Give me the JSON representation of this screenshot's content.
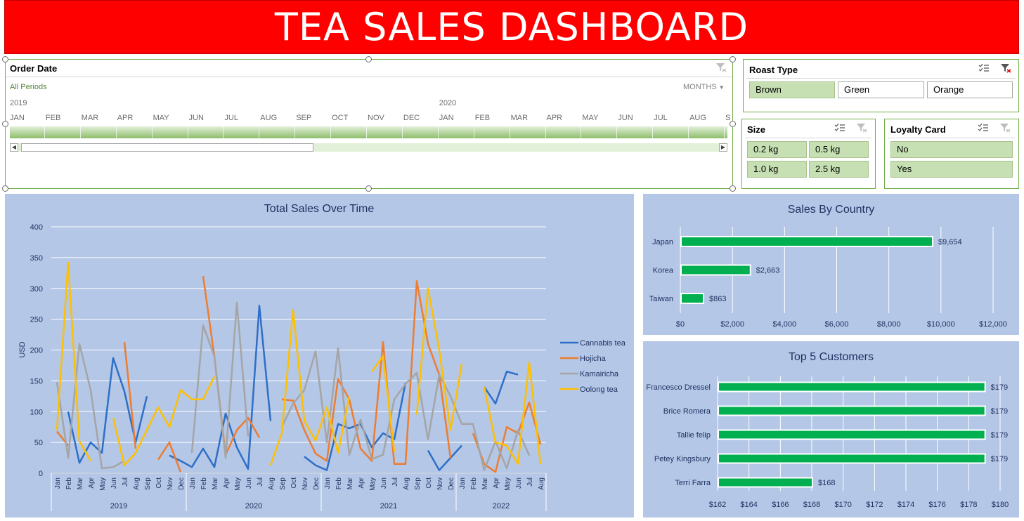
{
  "banner": {
    "title": "TEA SALES DASHBOARD"
  },
  "timeline": {
    "title": "Order Date",
    "period_label": "All Periods",
    "unit_label": "MONTHS",
    "years": [
      "2019",
      "2020"
    ],
    "months": [
      "JAN",
      "FEB",
      "MAR",
      "APR",
      "MAY",
      "JUN",
      "JUL",
      "AUG",
      "SEP",
      "OCT",
      "NOV",
      "DEC",
      "JAN",
      "FEB",
      "MAR",
      "APR",
      "MAY",
      "JUN",
      "JUL",
      "AUG",
      "S"
    ]
  },
  "roast": {
    "title": "Roast Type",
    "items": [
      {
        "label": "Brown",
        "selected": true
      },
      {
        "label": "Green",
        "selected": false
      },
      {
        "label": "Orange",
        "selected": false
      }
    ]
  },
  "size": {
    "title": "Size",
    "items": [
      {
        "label": "0.2 kg"
      },
      {
        "label": "0.5 kg"
      },
      {
        "label": "1.0 kg"
      },
      {
        "label": "2.5 kg"
      }
    ]
  },
  "loyalty": {
    "title": "Loyalty Card",
    "items": [
      {
        "label": "No"
      },
      {
        "label": "Yes"
      }
    ]
  },
  "colors": {
    "green": "#00b050",
    "accent": "#70ad47",
    "chart_bg": "#b4c7e7",
    "title_text": "#1f2f5f",
    "banner": "#ff0000"
  },
  "chart_data": [
    {
      "type": "line",
      "title": "Total Sales Over Time",
      "ylabel": "USD",
      "ylim": [
        0,
        400
      ],
      "yticks": [
        0,
        50,
        100,
        150,
        200,
        250,
        300,
        350,
        400
      ],
      "legend": "right",
      "years": [
        {
          "label": "2019",
          "count": 12
        },
        {
          "label": "2020",
          "count": 12
        },
        {
          "label": "2021",
          "count": 12
        },
        {
          "label": "2022",
          "count": 8
        }
      ],
      "categories": [
        "Jan",
        "Feb",
        "Mar",
        "Apr",
        "May",
        "Jun",
        "Jul",
        "Aug",
        "Sep",
        "Oct",
        "Nov",
        "Dec",
        "Jan",
        "Feb",
        "Mar",
        "Apr",
        "May",
        "Jun",
        "Jul",
        "Aug",
        "Sep",
        "Oct",
        "Nov",
        "Dec",
        "Jan",
        "Feb",
        "Mar",
        "Apr",
        "May",
        "Jun",
        "Jul",
        "Aug",
        "Sep",
        "Oct",
        "Nov",
        "Dec",
        "Jan",
        "Feb",
        "Mar",
        "Apr",
        "May",
        "Jun",
        "Jul",
        "Aug"
      ],
      "series": [
        {
          "name": "Cannabis tea",
          "color": "#2e6fc7",
          "values": [
            null,
            100,
            17,
            50,
            33,
            187,
            133,
            50,
            125,
            null,
            29,
            20,
            10,
            40,
            10,
            97,
            42,
            7,
            272,
            85,
            null,
            null,
            27,
            13,
            5,
            80,
            73,
            80,
            42,
            65,
            55,
            147,
            null,
            37,
            5,
            25,
            45,
            null,
            140,
            113,
            165,
            160,
            null,
            null
          ]
        },
        {
          "name": "Hojicha",
          "color": "#ed7d31",
          "values": [
            68,
            45,
            null,
            null,
            null,
            null,
            213,
            40,
            null,
            22,
            50,
            2,
            null,
            320,
            190,
            30,
            70,
            90,
            58,
            null,
            120,
            118,
            70,
            32,
            20,
            153,
            120,
            40,
            20,
            213,
            15,
            15,
            312,
            210,
            160,
            25,
            null,
            65,
            15,
            2,
            75,
            65,
            115,
            47
          ]
        },
        {
          "name": "Kamairicha",
          "color": "#a5a5a5",
          "values": [
            148,
            25,
            210,
            135,
            8,
            10,
            20,
            null,
            null,
            null,
            null,
            null,
            33,
            240,
            190,
            25,
            277,
            60,
            null,
            null,
            75,
            113,
            135,
            198,
            50,
            203,
            30,
            87,
            23,
            30,
            120,
            145,
            163,
            55,
            160,
            125,
            80,
            80,
            5,
            52,
            8,
            70,
            29,
            null
          ]
        },
        {
          "name": "Oolong tea",
          "color": "#ffc000",
          "values": [
            70,
            342,
            52,
            20,
            null,
            90,
            13,
            33,
            70,
            107,
            75,
            135,
            120,
            120,
            157,
            null,
            null,
            null,
            null,
            13,
            65,
            265,
            85,
            53,
            107,
            33,
            125,
            null,
            165,
            190,
            35,
            null,
            95,
            300,
            200,
            70,
            178,
            null,
            140,
            50,
            45,
            15,
            180,
            15
          ]
        }
      ]
    },
    {
      "type": "bar",
      "title": "Sales By Country",
      "categories": [
        "Japan",
        "Korea",
        "Taiwan"
      ],
      "values": [
        9654,
        2663,
        863
      ],
      "data_labels": [
        "$9,654",
        "$2,663",
        "$863"
      ],
      "xlim": [
        0,
        12000
      ],
      "xticks": [
        "$0",
        "$2,000",
        "$4,000",
        "$6,000",
        "$8,000",
        "$10,000",
        "$12,000"
      ]
    },
    {
      "type": "bar",
      "title": "Top 5 Customers",
      "categories": [
        "Francesco Dressel",
        "Brice Romera",
        "Tallie felip",
        "Petey Kingsbury",
        "Terri Farra"
      ],
      "values": [
        179,
        179,
        179,
        179,
        168
      ],
      "data_labels": [
        "$179",
        "$179",
        "$179",
        "$179",
        "$168"
      ],
      "xlim": [
        162,
        180
      ],
      "xticks": [
        "$162",
        "$164",
        "$166",
        "$168",
        "$170",
        "$172",
        "$174",
        "$176",
        "$178",
        "$180"
      ]
    }
  ]
}
